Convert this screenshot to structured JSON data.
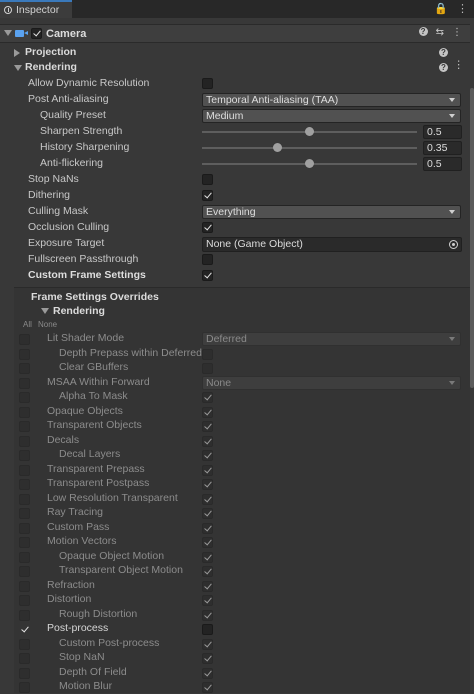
{
  "tab": {
    "title": "Inspector",
    "tools": [
      " 🔒",
      "⋮"
    ]
  },
  "component": {
    "title": "Camera"
  },
  "folds": {
    "projection": "Projection",
    "rendering": "Rendering"
  },
  "rendering": {
    "allow_dynamic_resolution": "Allow Dynamic Resolution",
    "post_anti_aliasing": "Post Anti-aliasing",
    "post_anti_aliasing_value": "Temporal Anti-aliasing (TAA)",
    "quality_preset": "Quality Preset",
    "quality_preset_value": "Medium",
    "sharpen_strength": "Sharpen Strength",
    "sharpen_strength_value": "0.5",
    "sharpen_strength_level": 0.5,
    "history_sharpening": "History Sharpening",
    "history_sharpening_value": "0.35",
    "history_sharpening_level": 0.35,
    "anti_flickering": "Anti-flickering",
    "anti_flickering_value": "0.5",
    "anti_flickering_level": 0.5,
    "stop_nans": "Stop NaNs",
    "dithering": "Dithering",
    "culling_mask": "Culling Mask",
    "culling_mask_value": "Everything",
    "occlusion_culling": "Occlusion Culling",
    "exposure_target": "Exposure Target",
    "exposure_target_value": "None (Game Object)",
    "fullscreen_passthrough": "Fullscreen Passthrough",
    "custom_frame_settings": "Custom Frame Settings"
  },
  "fso": {
    "title": "Frame Settings Overrides",
    "section": "Rendering",
    "all": "All",
    "none": "None",
    "lit_shader_mode": "Lit Shader Mode",
    "lit_shader_mode_value": "Deferred",
    "depth_prepass": "Depth Prepass within Deferred",
    "clear_gbuffers": "Clear GBuffers",
    "msaa": "MSAA Within Forward",
    "msaa_value": "None",
    "alpha_to_mask": "Alpha To Mask",
    "opaque_objects": "Opaque Objects",
    "transparent_objects": "Transparent Objects",
    "decals": "Decals",
    "decal_layers": "Decal Layers",
    "transparent_prepass": "Transparent Prepass",
    "transparent_postpass": "Transparent Postpass",
    "low_res_transparent": "Low Resolution Transparent",
    "ray_tracing": "Ray Tracing",
    "custom_pass": "Custom Pass",
    "motion_vectors": "Motion Vectors",
    "opaque_object_motion": "Opaque Object Motion",
    "transparent_object_motion": "Transparent Object Motion",
    "refraction": "Refraction",
    "distortion": "Distortion",
    "rough_distortion": "Rough Distortion",
    "post_process": "Post-process",
    "custom_post_process": "Custom Post-process",
    "stop_nan": "Stop NaN",
    "depth_of_field": "Depth Of Field",
    "motion_blur": "Motion Blur"
  }
}
